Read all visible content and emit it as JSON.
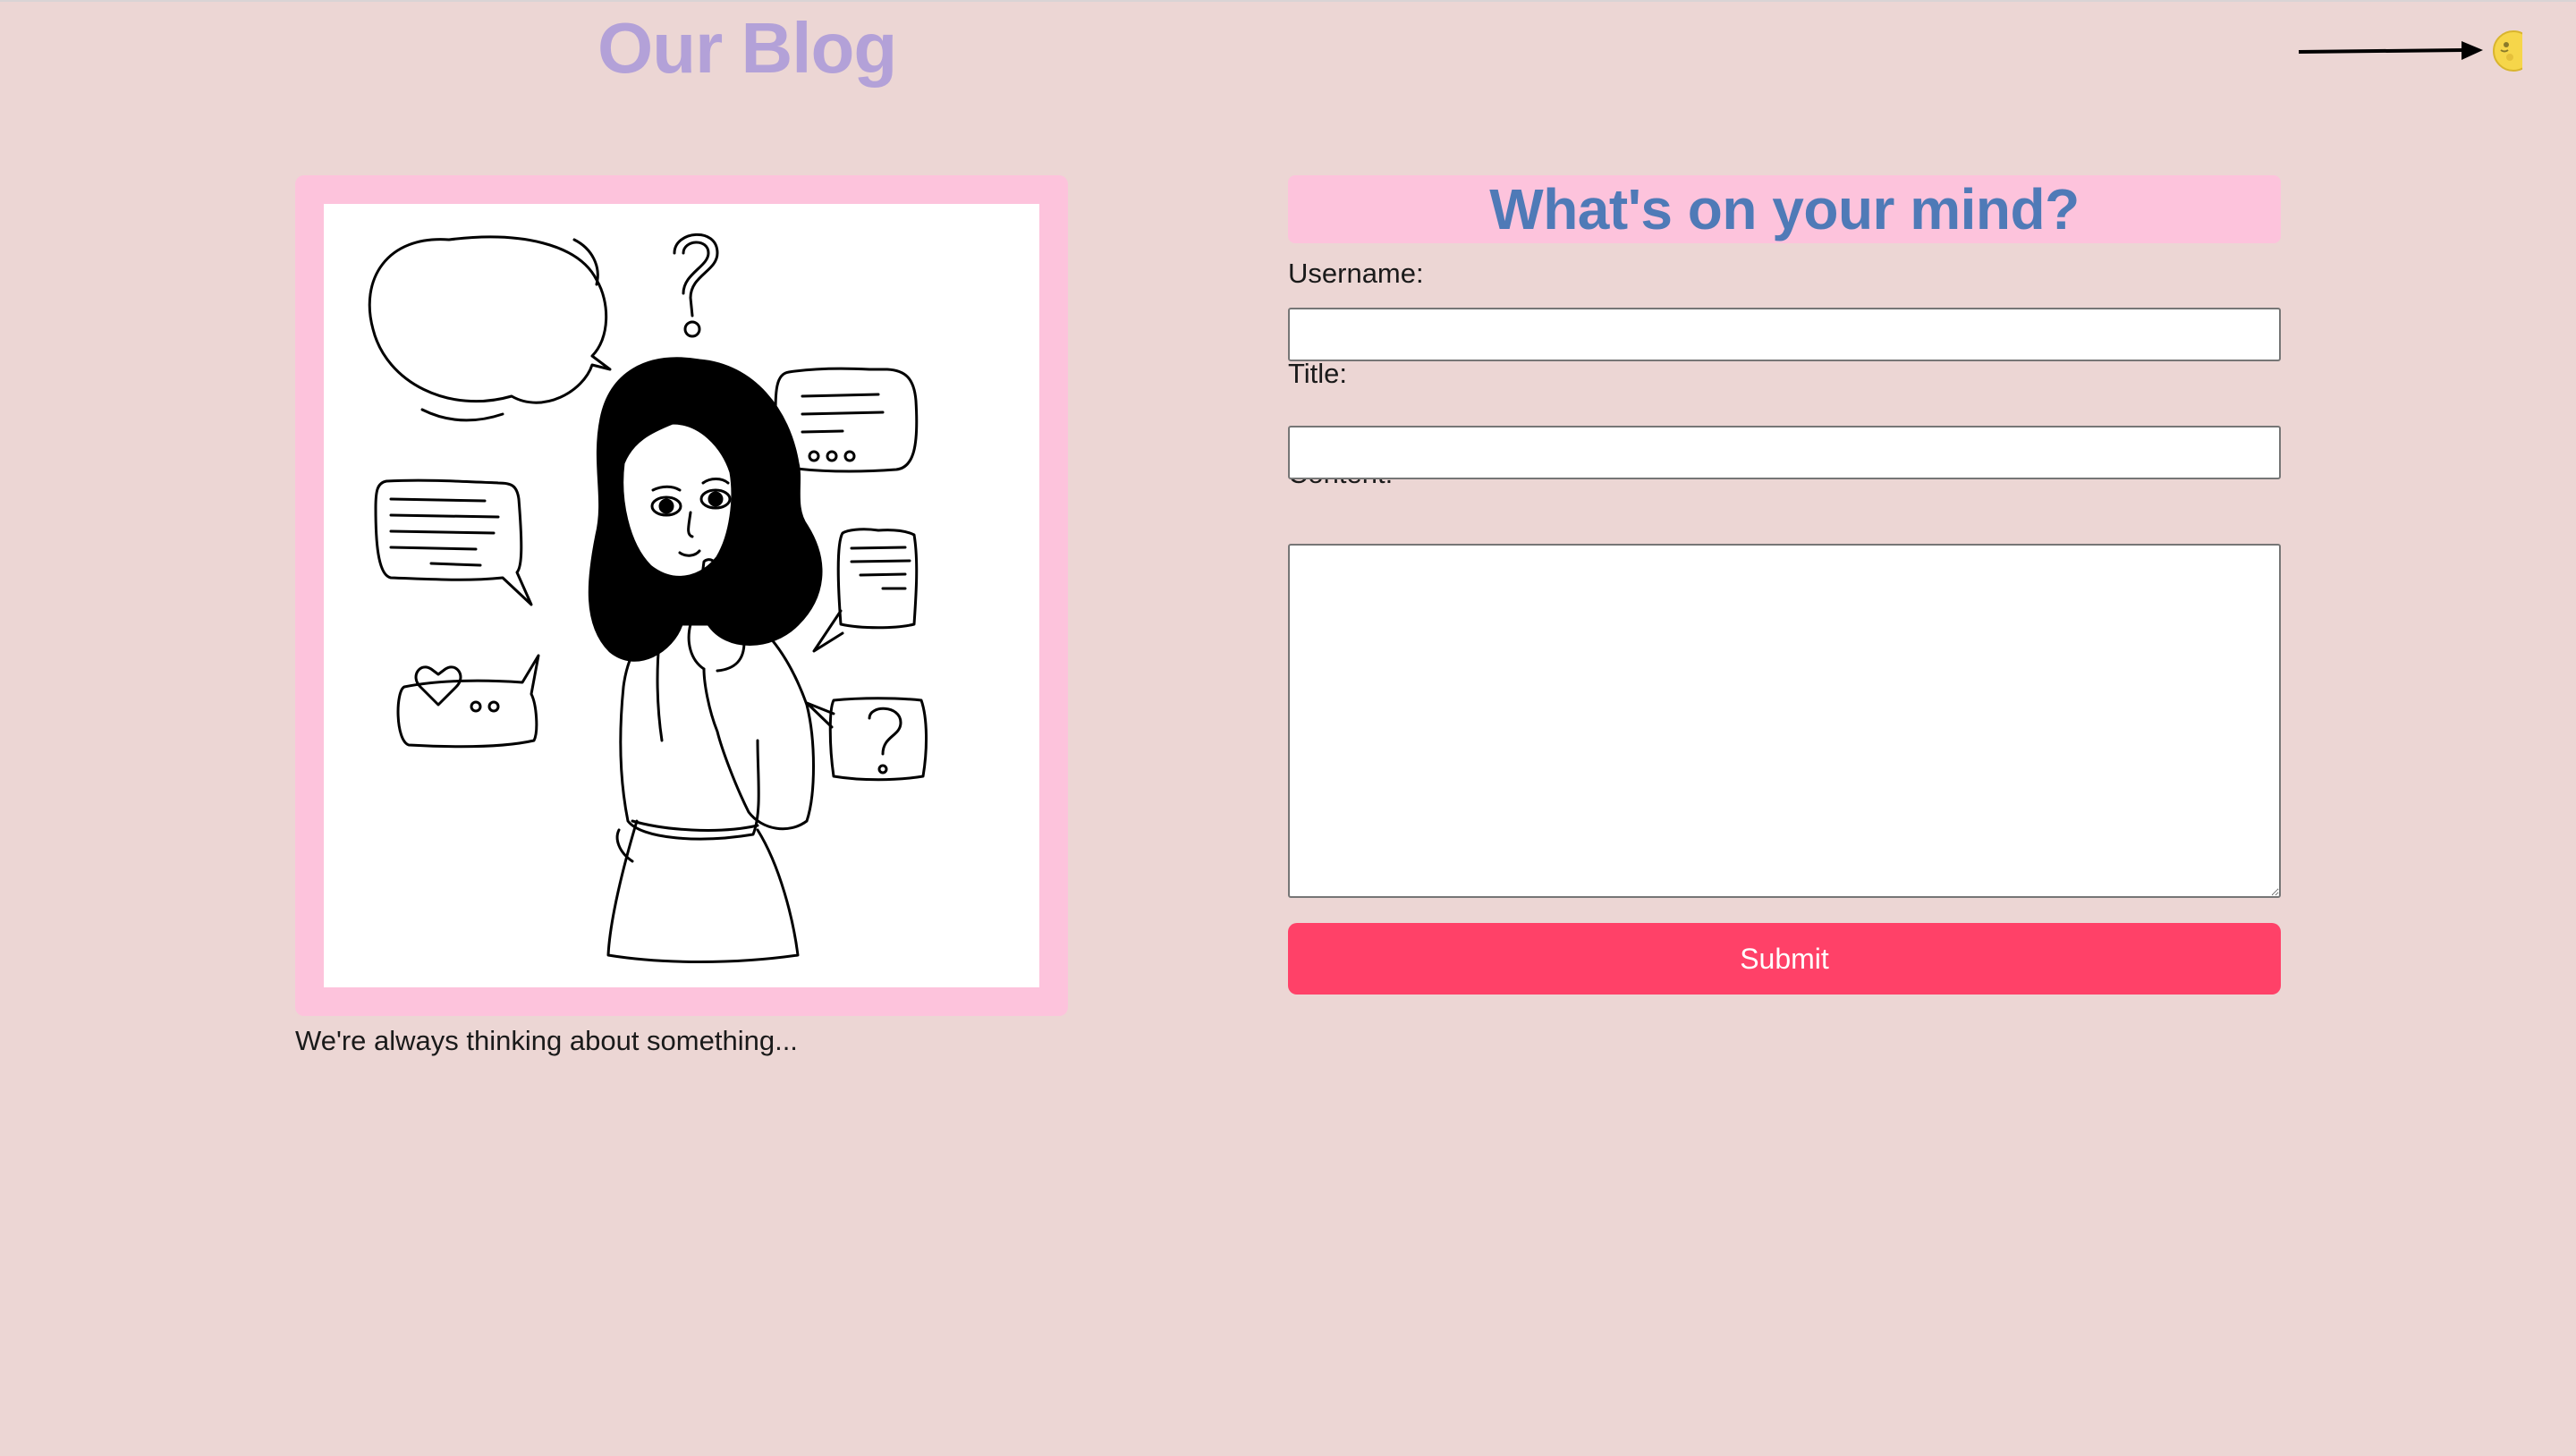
{
  "header": {
    "title": "Our Blog",
    "theme_toggle_icon": "moon-icon"
  },
  "illustration": {
    "subject": "woman-thinking-with-speech-bubbles-icon",
    "frame_color": "#fdc3dc",
    "caption": "We're always thinking about something..."
  },
  "form": {
    "heading": "What's on your mind?",
    "username_label": "Username:",
    "username_value": "",
    "title_label": "Title:",
    "title_value": "",
    "content_label": "Content:",
    "content_value": "",
    "submit_label": "Submit"
  },
  "colors": {
    "background": "#ecd6d4",
    "title": "#b3a1d8",
    "heading": "#4f7ab7",
    "accent_pink": "#fdc3dc",
    "submit": "#ff4168"
  }
}
